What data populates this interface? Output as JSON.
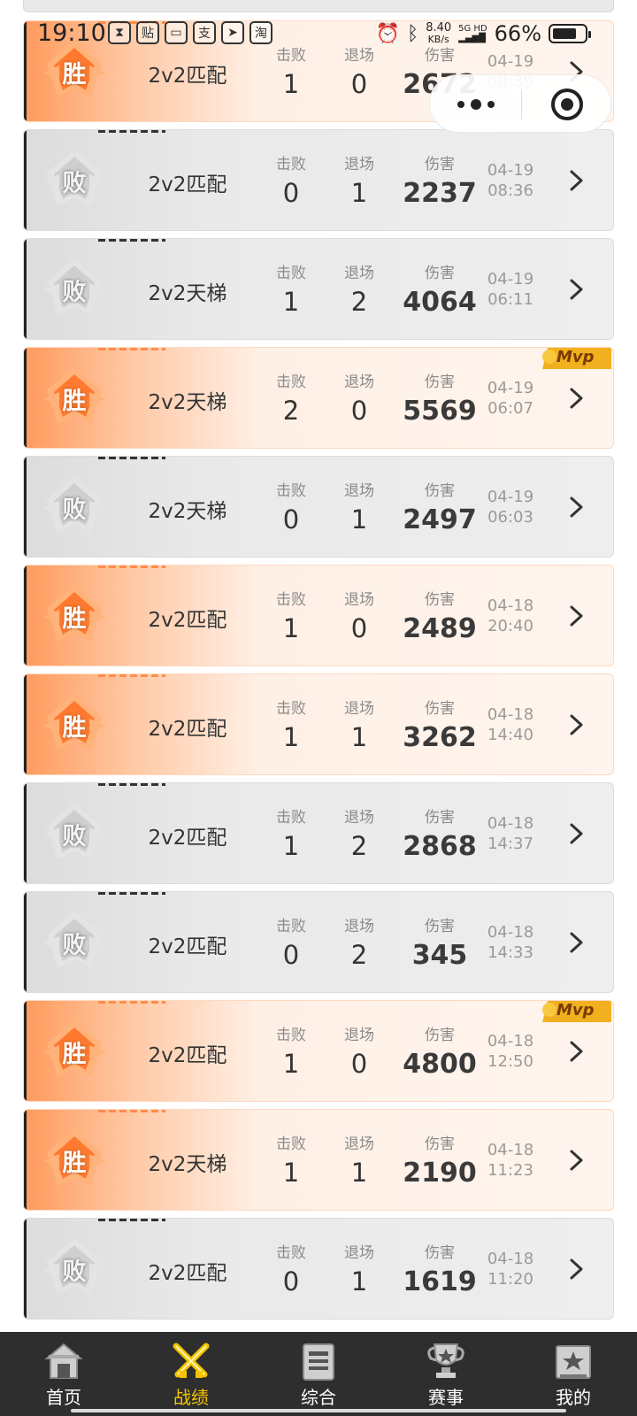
{
  "status_bar": {
    "time": "19:10",
    "app_icons": [
      "hourglass-icon",
      "tie-icon",
      "card-icon",
      "alipay-icon",
      "send-icon",
      "taobao-icon"
    ],
    "net_speed": "8.40",
    "net_unit": "KB/s",
    "signal_label": "5G HD",
    "battery": "66%"
  },
  "labels": {
    "kills": "击败",
    "exits": "退场",
    "damage": "伤害",
    "win": "胜",
    "lose": "败",
    "mvp": "Mvp"
  },
  "matches": [
    {
      "result": "win",
      "mode": "2v2匹配",
      "kills": "1",
      "exits": "0",
      "damage": "2672",
      "date": "04-19",
      "time": "08:39",
      "mvp": false
    },
    {
      "result": "lose",
      "mode": "2v2匹配",
      "kills": "0",
      "exits": "1",
      "damage": "2237",
      "date": "04-19",
      "time": "08:36",
      "mvp": false
    },
    {
      "result": "lose",
      "mode": "2v2天梯",
      "kills": "1",
      "exits": "2",
      "damage": "4064",
      "date": "04-19",
      "time": "06:11",
      "mvp": false
    },
    {
      "result": "win",
      "mode": "2v2天梯",
      "kills": "2",
      "exits": "0",
      "damage": "5569",
      "date": "04-19",
      "time": "06:07",
      "mvp": true
    },
    {
      "result": "lose",
      "mode": "2v2天梯",
      "kills": "0",
      "exits": "1",
      "damage": "2497",
      "date": "04-19",
      "time": "06:03",
      "mvp": false
    },
    {
      "result": "win",
      "mode": "2v2匹配",
      "kills": "1",
      "exits": "0",
      "damage": "2489",
      "date": "04-18",
      "time": "20:40",
      "mvp": false
    },
    {
      "result": "win",
      "mode": "2v2匹配",
      "kills": "1",
      "exits": "1",
      "damage": "3262",
      "date": "04-18",
      "time": "14:40",
      "mvp": false
    },
    {
      "result": "lose",
      "mode": "2v2匹配",
      "kills": "1",
      "exits": "2",
      "damage": "2868",
      "date": "04-18",
      "time": "14:37",
      "mvp": false
    },
    {
      "result": "lose",
      "mode": "2v2匹配",
      "kills": "0",
      "exits": "2",
      "damage": "345",
      "date": "04-18",
      "time": "14:33",
      "mvp": false
    },
    {
      "result": "win",
      "mode": "2v2匹配",
      "kills": "1",
      "exits": "0",
      "damage": "4800",
      "date": "04-18",
      "time": "12:50",
      "mvp": true
    },
    {
      "result": "win",
      "mode": "2v2天梯",
      "kills": "1",
      "exits": "1",
      "damage": "2190",
      "date": "04-18",
      "time": "11:23",
      "mvp": false
    },
    {
      "result": "lose",
      "mode": "2v2匹配",
      "kills": "0",
      "exits": "1",
      "damage": "1619",
      "date": "04-18",
      "time": "11:20",
      "mvp": false
    }
  ],
  "tabbar": {
    "items": [
      {
        "label": "首页",
        "icon": "home-icon",
        "active": false
      },
      {
        "label": "战绩",
        "icon": "crossed-swords-icon",
        "active": true
      },
      {
        "label": "综合",
        "icon": "document-icon",
        "active": false
      },
      {
        "label": "赛事",
        "icon": "trophy-icon",
        "active": false
      },
      {
        "label": "我的",
        "icon": "profile-icon",
        "active": false
      }
    ]
  },
  "colors": {
    "win_accent": "#ff8c4a",
    "active_tab": "#f5c400",
    "tabbar_bg": "#2e2e2e"
  }
}
